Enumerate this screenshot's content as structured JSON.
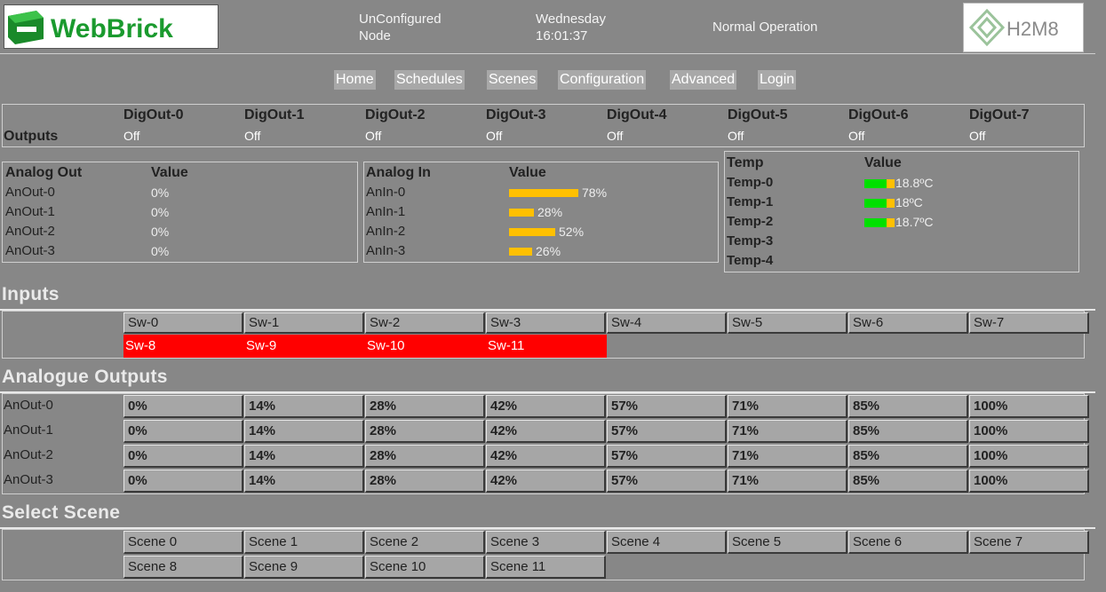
{
  "header": {
    "logo_text": "WebBrick",
    "node_line1": "UnConfigured",
    "node_line2": "Node",
    "day": "Wednesday",
    "time": "16:01:37",
    "status": "Normal Operation",
    "brand_text": "H2M8"
  },
  "nav": [
    "Home",
    "Schedules",
    "Scenes",
    "Configuration",
    "Advanced",
    "Login"
  ],
  "outputs": {
    "label": "Outputs",
    "items": [
      {
        "name": "DigOut-0",
        "state": "Off"
      },
      {
        "name": "DigOut-1",
        "state": "Off"
      },
      {
        "name": "DigOut-2",
        "state": "Off"
      },
      {
        "name": "DigOut-3",
        "state": "Off"
      },
      {
        "name": "DigOut-4",
        "state": "Off"
      },
      {
        "name": "DigOut-5",
        "state": "Off"
      },
      {
        "name": "DigOut-6",
        "state": "Off"
      },
      {
        "name": "DigOut-7",
        "state": "Off"
      }
    ]
  },
  "analog_out": {
    "header": "Analog Out",
    "value_header": "Value",
    "rows": [
      {
        "name": "AnOut-0",
        "value": "0%"
      },
      {
        "name": "AnOut-1",
        "value": "0%"
      },
      {
        "name": "AnOut-2",
        "value": "0%"
      },
      {
        "name": "AnOut-3",
        "value": "0%"
      }
    ]
  },
  "analog_in": {
    "header": "Analog In",
    "value_header": "Value",
    "rows": [
      {
        "name": "AnIn-0",
        "value": "78%",
        "level": 0.78
      },
      {
        "name": "AnIn-1",
        "value": "28%",
        "level": 0.28
      },
      {
        "name": "AnIn-2",
        "value": "52%",
        "level": 0.52
      },
      {
        "name": "AnIn-3",
        "value": "26%",
        "level": 0.26
      }
    ]
  },
  "temp": {
    "header": "Temp",
    "value_header": "Value",
    "rows": [
      {
        "name": "Temp-0",
        "value": "18.8ºC"
      },
      {
        "name": "Temp-1",
        "value": "18ºC"
      },
      {
        "name": "Temp-2",
        "value": "18.7ºC"
      },
      {
        "name": "Temp-3",
        "value": ""
      },
      {
        "name": "Temp-4",
        "value": ""
      }
    ]
  },
  "inputs": {
    "title": "Inputs",
    "row1": [
      "Sw-0",
      "Sw-1",
      "Sw-2",
      "Sw-3",
      "Sw-4",
      "Sw-5",
      "Sw-6",
      "Sw-7"
    ],
    "row2": [
      "Sw-8",
      "Sw-9",
      "Sw-10",
      "Sw-11"
    ]
  },
  "analogue_outputs": {
    "title": "Analogue Outputs",
    "rows": [
      "AnOut-0",
      "AnOut-1",
      "AnOut-2",
      "AnOut-3"
    ],
    "levels": [
      "0%",
      "14%",
      "28%",
      "42%",
      "57%",
      "71%",
      "85%",
      "100%"
    ]
  },
  "scenes": {
    "title": "Select Scene",
    "items": [
      "Scene 0",
      "Scene 1",
      "Scene 2",
      "Scene 3",
      "Scene 4",
      "Scene 5",
      "Scene 6",
      "Scene 7",
      "Scene 8",
      "Scene 9",
      "Scene 10",
      "Scene 11"
    ]
  },
  "colors": {
    "background": "#878787",
    "active_switch": "#ff0000",
    "bar": "#ffc000",
    "temp_bar": "#00e000"
  }
}
